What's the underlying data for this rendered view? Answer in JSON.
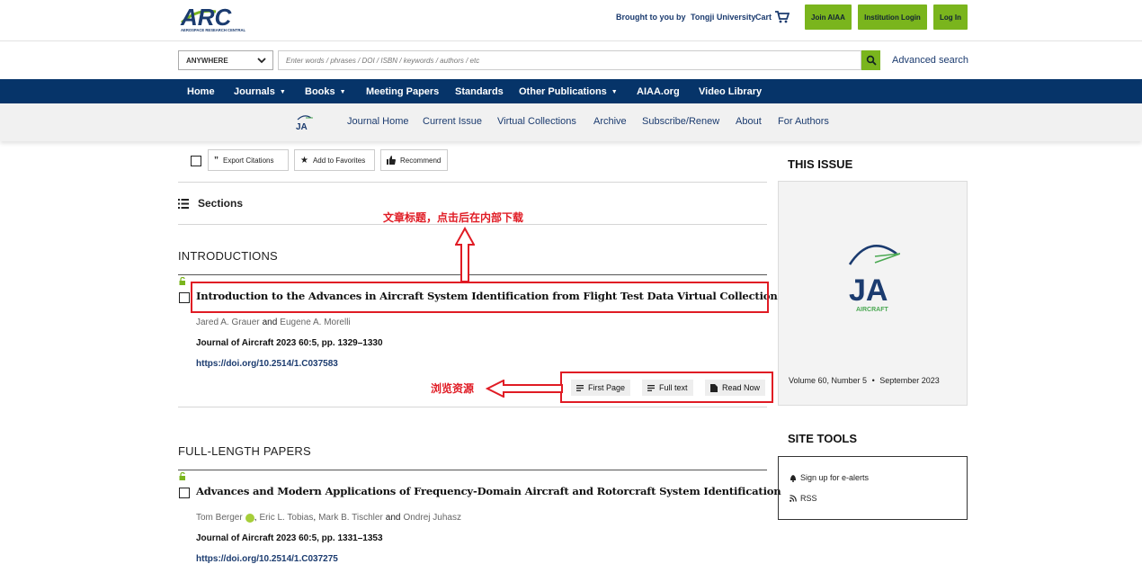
{
  "header": {
    "logo_text": "ARC",
    "logo_subtext": "AEROSPACE RESEARCH CENTRAL",
    "brought_by_label": "Brought to you by",
    "institution": "Tongji University",
    "cart_label": "Cart",
    "join_label": "Join AIAA",
    "institution_login_label": "Institution Login",
    "login_label": "Log In"
  },
  "search": {
    "scope_value": "ANYWHERE",
    "placeholder": "Enter words / phrases / DOI / ISBN / keywords / authors / etc",
    "advanced_label": "Advanced search"
  },
  "main_nav": {
    "home": "Home",
    "journals": "Journals",
    "books": "Books",
    "meeting_papers": "Meeting Papers",
    "standards": "Standards",
    "other_publications": "Other Publications",
    "aiaa_org": "AIAA.org",
    "video_library": "Video Library"
  },
  "journal_nav": {
    "logo_text": "JA",
    "journal_home": "Journal Home",
    "current_issue": "Current Issue",
    "virtual_collections": "Virtual Collections",
    "archive": "Archive",
    "subscribe": "Subscribe/Renew",
    "about": "About",
    "for_authors": "For Authors"
  },
  "actions": {
    "export_citations": "Export Citations",
    "add_to_favorites": "Add to Favorites",
    "recommend": "Recommend"
  },
  "sections_label": "Sections",
  "introductions": {
    "heading": "INTRODUCTIONS",
    "article": {
      "title": "Introduction to the Advances in Aircraft System Identification from Flight Test Data Virtual Collection",
      "author1": "Jared A. Grauer",
      "and": "and",
      "author2": "Eugene A. Morelli",
      "citation": "Journal of Aircraft 2023 60:5, pp. 1329–1330",
      "doi": "https://doi.org/10.2514/1.C037583",
      "first_page": "First Page",
      "full_text": "Full text",
      "read_now": "Read Now"
    }
  },
  "annotations": {
    "title_note": "文章标题，点击后在内部下载",
    "browse_note": "浏览资源"
  },
  "full_length": {
    "heading": "FULL-LENGTH PAPERS",
    "article": {
      "title": "Advances and Modern Applications of Frequency-Domain Aircraft and Rotorcraft System Identification",
      "author1": "Tom Berger",
      "sep": ",",
      "author2": "Eric L. Tobias",
      "author3": "Mark B. Tischler",
      "and": "and",
      "author4": "Ondrej Juhasz",
      "citation": "Journal of Aircraft 2023 60:5, pp. 1331–1353",
      "doi": "https://doi.org/10.2514/1.C037275"
    }
  },
  "sidebar": {
    "this_issue_title": "THIS ISSUE",
    "cover_ja": "JA",
    "cover_sub": "AIRCRAFT",
    "volume": "Volume 60, Number 5",
    "bullet": "•",
    "date": "September 2023",
    "site_tools_title": "SITE TOOLS",
    "ealerts": "Sign up for e-alerts",
    "rss": "RSS"
  },
  "colors": {
    "navy": "#063469",
    "accent_green": "#7ab51d",
    "annotation_red": "#e01b24",
    "link_blue": "#1b3b6f"
  }
}
